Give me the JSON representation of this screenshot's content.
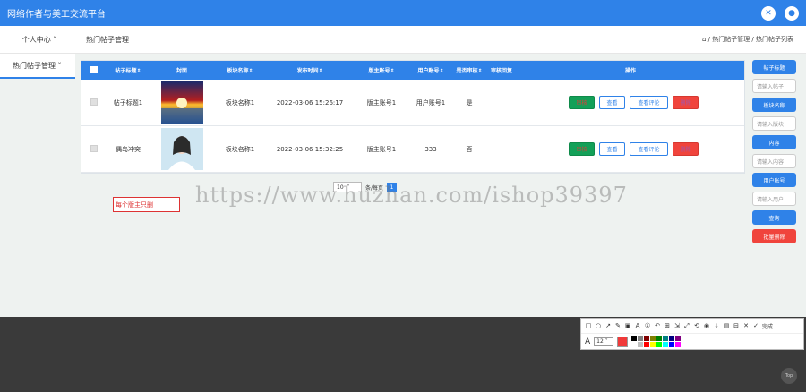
{
  "header": {
    "title": "网络作者与美工交流平台",
    "icons": [
      "close-icon",
      "user-icon"
    ]
  },
  "subbar": {
    "personal_center": "个人中心",
    "page_title": "热门帖子管理",
    "breadcrumb": "⌂ / 热门帖子管理 / 热门帖子列表"
  },
  "sidebar": {
    "items": [
      {
        "label": "热门帖子管理"
      }
    ]
  },
  "table": {
    "columns": [
      "帖子标题",
      "封面",
      "板块名称",
      "发布时间",
      "版主账号",
      "用户账号",
      "是否审核",
      "审核回复",
      "操作"
    ],
    "rows": [
      {
        "title": "帖子标题1",
        "board": "板块名称1",
        "time": "2022-03-06 15:26:17",
        "moderator": "版主账号1",
        "user": "用户账号1",
        "reviewed": "是",
        "reply": ""
      },
      {
        "title": "偶岛冲突",
        "board": "板块名称1",
        "time": "2022-03-06 15:32:25",
        "moderator": "版主账号1",
        "user": "333",
        "reviewed": "否",
        "reply": ""
      }
    ],
    "actions": {
      "review": "审核",
      "view": "查看",
      "view_comments": "查看评论",
      "delete": "删除"
    }
  },
  "pager": {
    "page_size": "10",
    "per_page_label": "条/每页",
    "current_page": "1"
  },
  "annotation": "每个版主只删",
  "watermark": "https://www.huzhan.com/ishop39397",
  "search_panel": {
    "post_title_btn": "帖子标题",
    "post_title_ph": "请输入帖子",
    "board_btn": "板块名称",
    "board_ph": "请输入版块",
    "content_btn": "内容",
    "content_ph": "请输入内容",
    "user_btn": "用户账号",
    "user_ph": "请输入用户",
    "search_btn": "查询",
    "bulk_delete_btn": "批量删除"
  },
  "toolbar": {
    "done_label": "完成",
    "font_size": "12"
  },
  "palette": [
    "#000000",
    "#808080",
    "#800000",
    "#808000",
    "#008000",
    "#008080",
    "#000080",
    "#800080",
    "#ffffff",
    "#c0c0c0",
    "#ff0000",
    "#ffff00",
    "#00ff00",
    "#00ffff",
    "#0000ff",
    "#ff00ff"
  ],
  "colors": {
    "accent": "#2f82e8",
    "danger": "#f0443c",
    "success": "#13a058",
    "current_color": "#f03a3a"
  }
}
